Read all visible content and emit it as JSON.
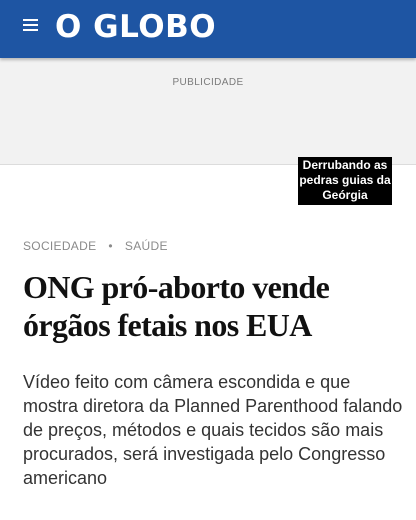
{
  "header": {
    "menu_icon": "hamburger-menu-icon",
    "logo_text": "O GLOBO",
    "background_color": "#1e55a3"
  },
  "ad": {
    "label": "PUBLICIDADE"
  },
  "overlay_caption": {
    "text": "Derrubando as pedras guias da Geórgia"
  },
  "article": {
    "kicker": {
      "section": "SOCIEDADE",
      "subsection": "SAÚDE"
    },
    "headline": "ONG pró-aborto vende órgãos fetais nos EUA",
    "subtitle": "Vídeo feito com câmera escondida e que mostra diretora da Planned Parenthood falando de preços, métodos e quais tecidos são mais procurados, será investigada pelo Congresso americano"
  }
}
